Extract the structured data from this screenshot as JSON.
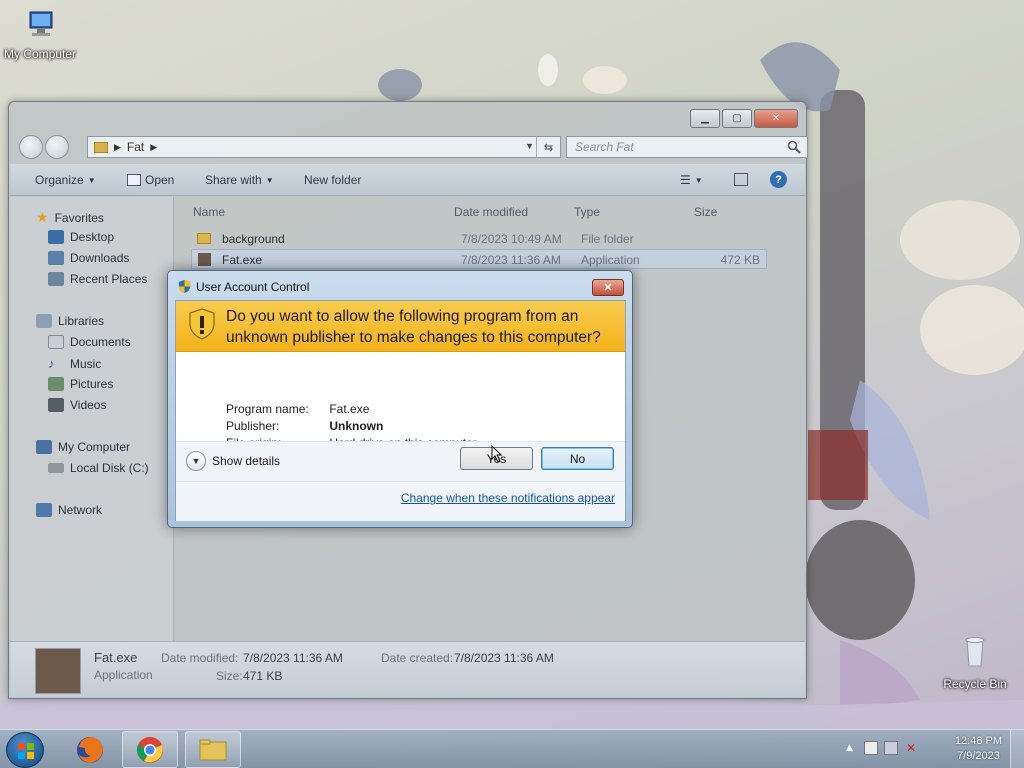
{
  "desktop": {
    "icons": {
      "my_computer": "My Computer",
      "recycle_bin": "Recycle Bin"
    }
  },
  "explorer": {
    "address": {
      "folder": "Fat"
    },
    "search": {
      "placeholder": "Search Fat"
    },
    "toolbar": {
      "organize": "Organize",
      "open": "Open",
      "share_with": "Share with",
      "new_folder": "New folder"
    },
    "nav": {
      "favorites": "Favorites",
      "desktop": "Desktop",
      "downloads": "Downloads",
      "recent_places": "Recent Places",
      "libraries": "Libraries",
      "documents": "Documents",
      "music": "Music",
      "pictures": "Pictures",
      "videos": "Videos",
      "my_computer": "My Computer",
      "local_disk": "Local Disk (C:)",
      "network": "Network"
    },
    "columns": {
      "name": "Name",
      "date_modified": "Date modified",
      "type": "Type",
      "size": "Size"
    },
    "files": [
      {
        "name": "background",
        "date": "7/8/2023 10:49 AM",
        "type": "File folder",
        "size": ""
      },
      {
        "name": "Fat.exe",
        "date": "7/8/2023 11:36 AM",
        "type": "Application",
        "size": "472 KB"
      }
    ],
    "details": {
      "name": "Fat.exe",
      "kind": "Application",
      "date_modified_label": "Date modified:",
      "date_modified": "7/8/2023 11:36 AM",
      "date_created_label": "Date created:",
      "date_created": "7/8/2023 11:36 AM",
      "size_label": "Size:",
      "size": "471 KB"
    }
  },
  "uac": {
    "title": "User Account Control",
    "question": "Do you want to allow the following program from an unknown publisher to make changes to this computer?",
    "program_name_label": "Program name:",
    "program_name": "Fat.exe",
    "publisher_label": "Publisher:",
    "publisher": "Unknown",
    "file_origin_label": "File origin:",
    "file_origin": "Hard drive on this computer",
    "show_details": "Show details",
    "yes": "Yes",
    "no": "No",
    "link": "Change when these notifications appear"
  },
  "taskbar": {
    "time": "12:48 PM",
    "date": "7/9/2023"
  }
}
